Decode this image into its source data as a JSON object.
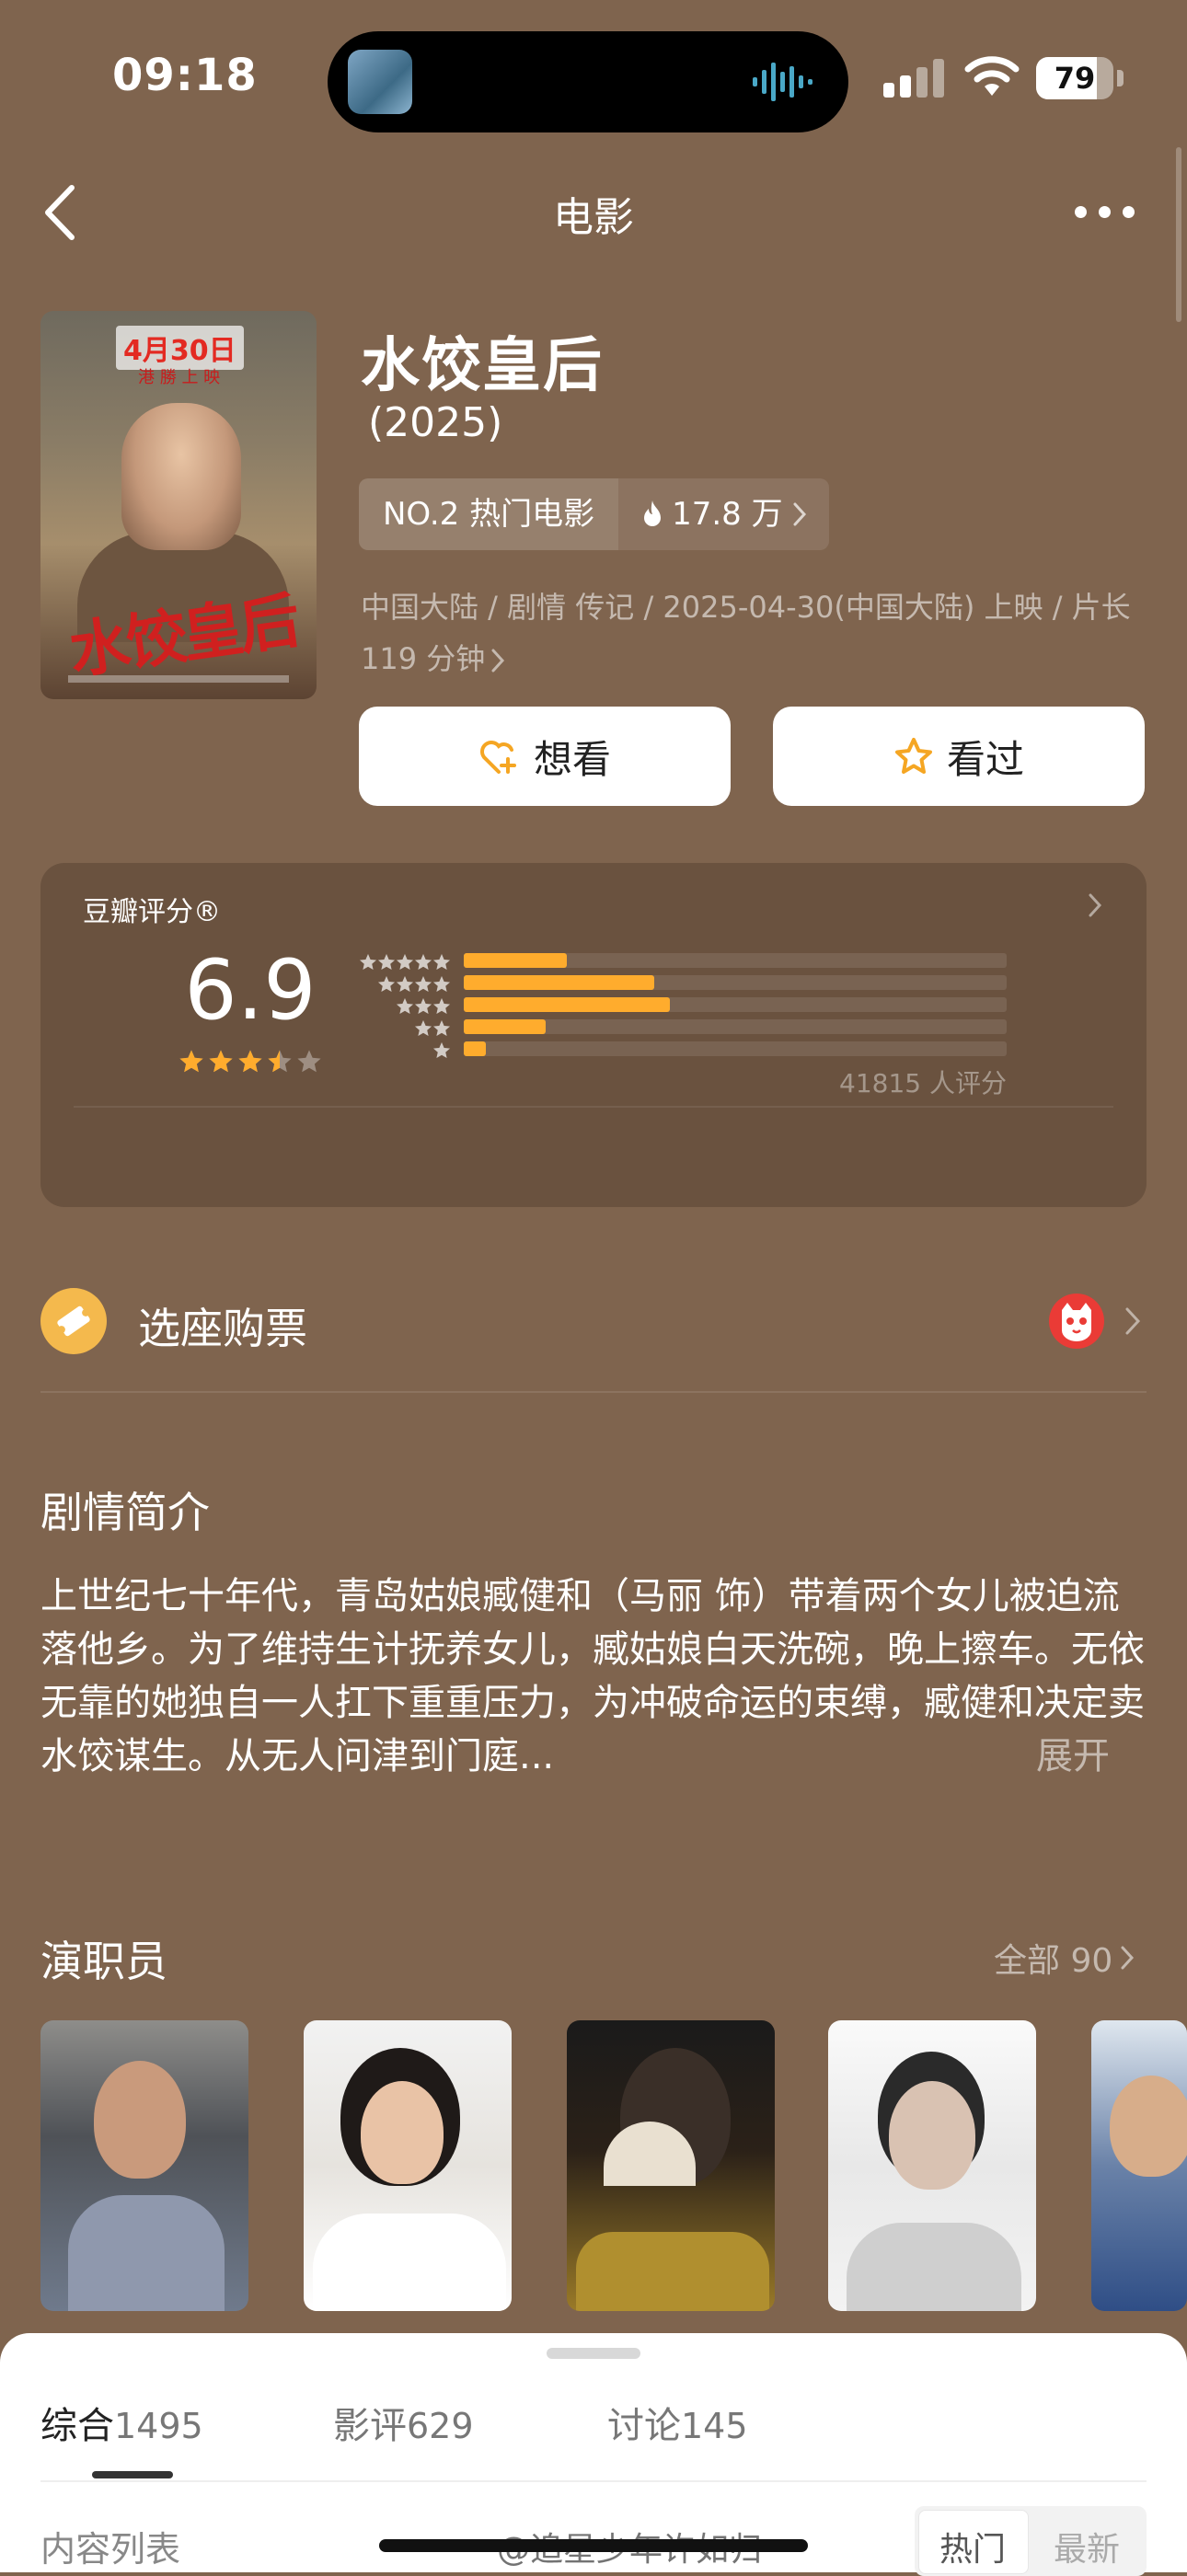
{
  "status_bar": {
    "time": "09:18",
    "battery": "79",
    "battery_level": 0.79
  },
  "nav": {
    "title": "电影"
  },
  "movie": {
    "title": "水饺皇后",
    "year": "(2025)",
    "rank_label": "NO.2 热门电影",
    "heat": "17.8 万",
    "meta": "中国大陆 / 剧情 传记 / 2025-04-30(中国大陆) 上映 / 片长 119 分钟",
    "poster": {
      "date": "4月30日",
      "sub": "港 勝 上 映",
      "title": "水饺皇后"
    }
  },
  "actions": {
    "want": "想看",
    "seen": "看过"
  },
  "rating": {
    "label": "豆瓣评分®",
    "score": "6.9",
    "stars": 3.5,
    "count_text": "41815 人评分",
    "distribution": [
      {
        "stars": 5,
        "fraction": 0.19
      },
      {
        "stars": 4,
        "fraction": 0.35
      },
      {
        "stars": 3,
        "fraction": 0.38
      },
      {
        "stars": 2,
        "fraction": 0.15
      },
      {
        "stars": 1,
        "fraction": 0.04
      }
    ]
  },
  "tickets": {
    "label": "选座购票"
  },
  "synopsis": {
    "heading": "剧情简介",
    "text": "上世纪七十年代，青岛姑娘臧健和（马丽 饰）带着两个女儿被迫流落他乡。为了维持生计抚养女儿，臧姑娘白天洗碗，晚上擦车。无依无靠的她独自一人扛下重重压力，为冲破命运的束缚，臧健和决定卖水饺谋生。从无人问津到门庭...",
    "expand": "展开"
  },
  "cast": {
    "heading": "演职员",
    "all": "全部 90"
  },
  "bottom_tabs": [
    {
      "label": "综合",
      "count": "1495"
    },
    {
      "label": "影评",
      "count": "629"
    },
    {
      "label": "讨论",
      "count": "145"
    }
  ],
  "content_list": {
    "label": "内容列表",
    "sort_hot": "热门",
    "sort_new": "最新"
  },
  "watermark": "@追星少年许如归",
  "colors": {
    "background": "#7f644e",
    "accent_star": "#ffac2d",
    "ticket_icon": "#f4b94d",
    "cat_logo": "#ea3b36"
  }
}
